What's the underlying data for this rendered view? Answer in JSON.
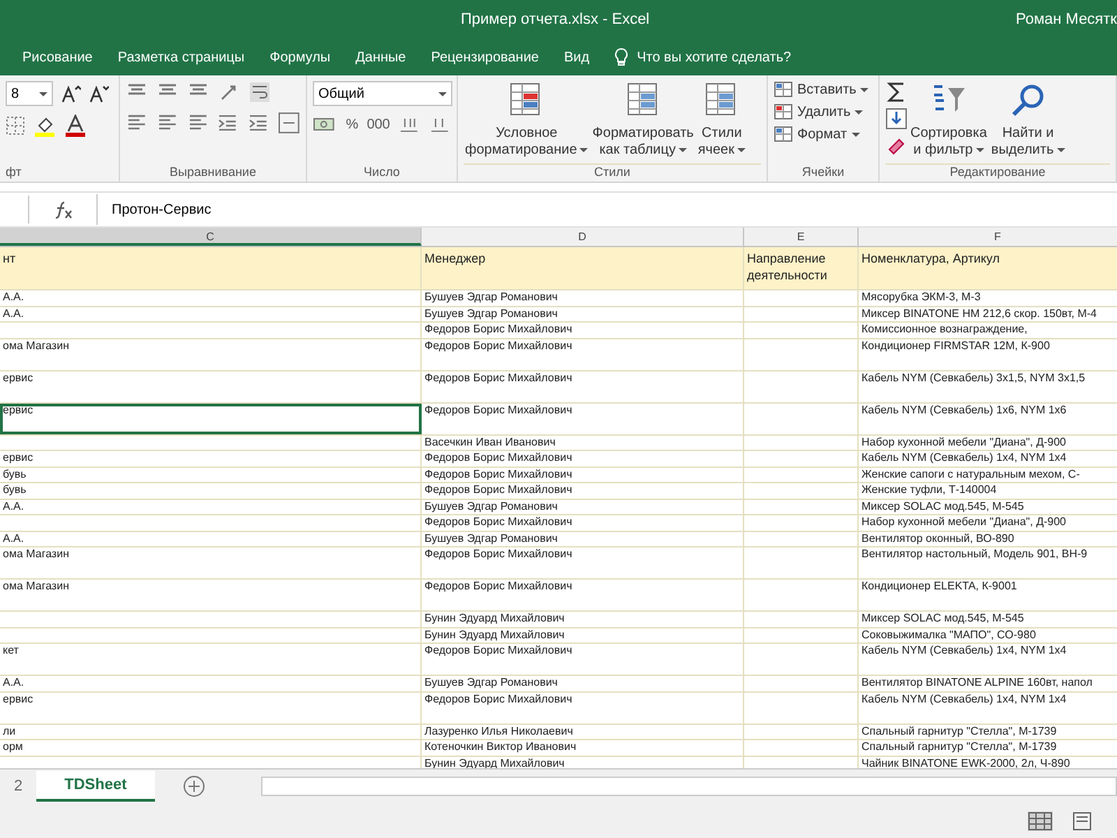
{
  "window": {
    "title": "Пример отчета.xlsx - Excel",
    "user": "Роман Месятк"
  },
  "ribbon_tabs": [
    {
      "label": "Рисование",
      "selected": false
    },
    {
      "label": "Разметка страницы",
      "selected": false
    },
    {
      "label": "Формулы",
      "selected": false
    },
    {
      "label": "Данные",
      "selected": false
    },
    {
      "label": "Рецензирование",
      "selected": false
    },
    {
      "label": "Вид",
      "selected": false
    }
  ],
  "tell_me": {
    "placeholder": "Что вы хотите сделать?"
  },
  "ribbon": {
    "font_size": "8",
    "number_format": "Общий",
    "percent": "%",
    "thousands": "000",
    "group_labels": [
      "фт",
      "Выравнивание",
      "Число",
      "Стили",
      "Ячейки",
      "Редактирование"
    ],
    "style_buttons": [
      {
        "line1": "Условное",
        "line2": "форматирование"
      },
      {
        "line1": "Форматировать",
        "line2": "как таблицу"
      },
      {
        "line1": "Стили",
        "line2": "ячеек"
      }
    ],
    "cell_buttons": [
      "Вставить",
      "Удалить",
      "Формат"
    ],
    "edit_buttons": [
      {
        "line1": "Сортировка",
        "line2": "и фильтр"
      },
      {
        "line1": "Найти и",
        "line2": "выделить"
      }
    ]
  },
  "formula_bar": {
    "value": "Протон-Сервис"
  },
  "sheet": {
    "column_letters": [
      "C",
      "D",
      "E",
      "F"
    ],
    "header": [
      "нт",
      "Менеджер",
      "Направление деятельности",
      "Номенклатура, Артикул"
    ],
    "rows": [
      {
        "tall": false,
        "selected": false,
        "cells": [
          "А.А.",
          "Бушуев Эдгар Романович",
          "",
          "Мясорубка ЭКМ-3, М-3"
        ]
      },
      {
        "tall": false,
        "selected": false,
        "cells": [
          "А.А.",
          "Бушуев Эдгар Романович",
          "",
          "Миксер BINATONE HM 212,6 скор. 150вт, М-4"
        ]
      },
      {
        "tall": false,
        "selected": false,
        "cells": [
          "",
          "Федоров Борис Михайлович",
          "",
          "Комиссионное вознаграждение,"
        ]
      },
      {
        "tall": true,
        "selected": false,
        "cells": [
          "ома Магазин",
          "Федоров Борис Михайлович",
          "",
          "Кондиционер FIRMSTAR 12M, К-900"
        ]
      },
      {
        "tall": true,
        "selected": false,
        "cells": [
          "ервис",
          "Федоров Борис Михайлович",
          "",
          "Кабель NYM (Севкабель) 3х1,5, NYM 3х1,5"
        ]
      },
      {
        "tall": true,
        "selected": true,
        "cells": [
          "ервис",
          "Федоров Борис Михайлович",
          "",
          "Кабель NYM (Севкабель) 1х6, NYM 1х6"
        ]
      },
      {
        "tall": false,
        "selected": false,
        "cells": [
          "",
          "Васечкин Иван Иванович",
          "",
          "Набор кухонной мебели \"Диана\", Д-900"
        ]
      },
      {
        "tall": false,
        "selected": false,
        "cells": [
          "ервис",
          "Федоров Борис Михайлович",
          "",
          "Кабель NYM (Севкабель) 1х4, NYM 1х4"
        ]
      },
      {
        "tall": false,
        "selected": false,
        "cells": [
          "бувь",
          "Федоров Борис Михайлович",
          "",
          "Женские сапоги с натуральным мехом, С-"
        ]
      },
      {
        "tall": false,
        "selected": false,
        "cells": [
          "бувь",
          "Федоров Борис Михайлович",
          "",
          "Женские туфли, Т-140004"
        ]
      },
      {
        "tall": false,
        "selected": false,
        "cells": [
          "А.А.",
          "Бушуев Эдгар Романович",
          "",
          "Миксер SOLAC мод.545, М-545"
        ]
      },
      {
        "tall": false,
        "selected": false,
        "cells": [
          "",
          "Федоров Борис Михайлович",
          "",
          "Набор кухонной мебели \"Диана\", Д-900"
        ]
      },
      {
        "tall": false,
        "selected": false,
        "cells": [
          "А.А.",
          "Бушуев Эдгар Романович",
          "",
          "Вентилятор оконный, ВО-890"
        ]
      },
      {
        "tall": true,
        "selected": false,
        "cells": [
          "ома Магазин",
          "Федоров Борис Михайлович",
          "",
          "Вентилятор настольный, Модель 901, ВН-9"
        ]
      },
      {
        "tall": true,
        "selected": false,
        "cells": [
          "ома Магазин",
          "Федоров Борис Михайлович",
          "",
          "Кондиционер ELEKTA, К-9001"
        ]
      },
      {
        "tall": false,
        "selected": false,
        "cells": [
          "",
          "Бунин Эдуард Михайлович",
          "",
          "Миксер SOLAC мод.545, М-545"
        ]
      },
      {
        "tall": false,
        "selected": false,
        "cells": [
          "",
          "Бунин Эдуард Михайлович",
          "",
          "Соковыжималка \"МАПО\", СО-980"
        ]
      },
      {
        "tall": true,
        "selected": false,
        "cells": [
          "кет",
          "Федоров Борис Михайлович",
          "",
          "Кабель NYM (Севкабель) 1х4, NYM 1х4"
        ]
      },
      {
        "tall": false,
        "selected": false,
        "cells": [
          "А.А.",
          "Бушуев Эдгар Романович",
          "",
          "Вентилятор BINATONE ALPINE 160вт, напол"
        ]
      },
      {
        "tall": true,
        "selected": false,
        "cells": [
          "ервис",
          "Федоров Борис Михайлович",
          "",
          "Кабель NYM (Севкабель) 1х4, NYM 1х4"
        ]
      },
      {
        "tall": false,
        "selected": false,
        "cells": [
          "ли",
          "Лазуренко Илья Николаевич",
          "",
          "Спальный гарнитур \"Стелла\", М-1739"
        ]
      },
      {
        "tall": false,
        "selected": false,
        "cells": [
          "орм",
          "Котеночкин Виктор Иванович",
          "",
          "Спальный гарнитур \"Стелла\", М-1739"
        ]
      },
      {
        "tall": false,
        "selected": false,
        "cells": [
          "",
          "Бунин Эдуард Михайлович",
          "",
          "Чайник BINATONE EWK-2000, 2л, Ч-890"
        ]
      }
    ]
  },
  "sheet_tabs": [
    {
      "label": "2",
      "selected": false
    },
    {
      "label": "TDSheet",
      "selected": true
    }
  ]
}
